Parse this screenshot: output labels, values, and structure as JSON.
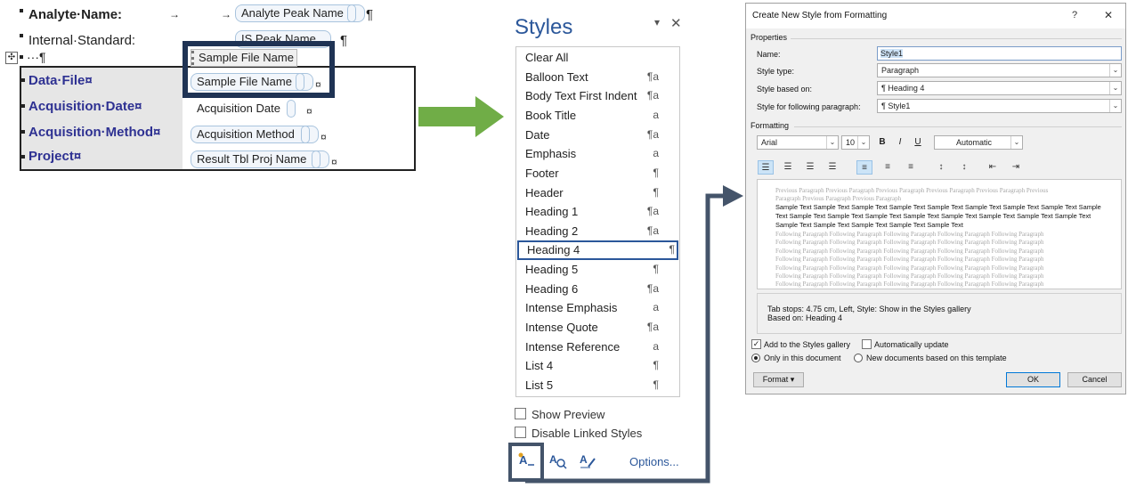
{
  "document": {
    "analyte_label": "Analyte·Name:",
    "analyte_field": "Analyte Peak Name",
    "internal_label": "Internal·Standard:",
    "is_field": "IS Peak Name",
    "empty_para": "···¶",
    "floating_field": "Sample File Name",
    "tab_arrow": "→",
    "pilcrow": "¶",
    "cell_mark": "¤",
    "rows": [
      {
        "label": "Data·File¤",
        "field": "Sample File Name"
      },
      {
        "label": "Acquisition·Date¤",
        "field": "Acquisition Date"
      },
      {
        "label": "Acquisition·Method¤",
        "field": "Acquisition Method"
      },
      {
        "label": "Project¤",
        "field": "Result Tbl Proj Name"
      }
    ]
  },
  "styles_pane": {
    "title": "Styles",
    "close": "✕",
    "dropdown": "▾",
    "items": [
      {
        "name": "Clear All",
        "icon": ""
      },
      {
        "name": "Balloon Text",
        "icon": "¶a"
      },
      {
        "name": "Body Text First Indent",
        "icon": "¶a"
      },
      {
        "name": "Book Title",
        "icon": "a"
      },
      {
        "name": "Date",
        "icon": "¶a"
      },
      {
        "name": "Emphasis",
        "icon": "a"
      },
      {
        "name": "Footer",
        "icon": "¶"
      },
      {
        "name": "Header",
        "icon": "¶"
      },
      {
        "name": "Heading 1",
        "icon": "¶a"
      },
      {
        "name": "Heading 2",
        "icon": "¶a"
      },
      {
        "name": "Heading 4",
        "icon": "¶"
      },
      {
        "name": "Heading 5",
        "icon": "¶"
      },
      {
        "name": "Heading 6",
        "icon": "¶a"
      },
      {
        "name": "Intense Emphasis",
        "icon": "a"
      },
      {
        "name": "Intense Quote",
        "icon": "¶a"
      },
      {
        "name": "Intense Reference",
        "icon": "a"
      },
      {
        "name": "List 4",
        "icon": "¶"
      },
      {
        "name": "List 5",
        "icon": "¶"
      }
    ],
    "selected_index": 10,
    "show_preview": "Show Preview",
    "disable_linked": "Disable Linked Styles",
    "options": "Options..."
  },
  "dialog": {
    "title": "Create New Style from Formatting",
    "help": "?",
    "close": "✕",
    "properties_heading": "Properties",
    "name_label": "Name:",
    "name_value": "Style1",
    "style_type_label": "Style type:",
    "style_type_value": "Paragraph",
    "based_on_label": "Style based on:",
    "based_on_value": "¶  Heading 4",
    "following_label": "Style for following paragraph:",
    "following_value": "¶  Style1",
    "formatting_heading": "Formatting",
    "font": "Arial",
    "size": "10",
    "bold": "B",
    "italic": "I",
    "underline": "U",
    "color": "Automatic",
    "preview_prev": [
      "Previous Paragraph Previous Paragraph Previous Paragraph Previous Paragraph Previous Paragraph Previous",
      "Paragraph Previous Paragraph Previous Paragraph"
    ],
    "preview_sample": [
      "Sample Text Sample Text Sample Text Sample Text Sample Text Sample Text Sample Text Sample Text Sample",
      "Text Sample Text Sample Text Sample Text Sample Text Sample Text Sample Text Sample Text Sample Text",
      "Sample Text Sample Text Sample Text Sample Text Sample Text"
    ],
    "preview_next": [
      "Following Paragraph Following Paragraph Following Paragraph Following Paragraph Following Paragraph",
      "Following Paragraph Following Paragraph Following Paragraph Following Paragraph Following Paragraph",
      "Following Paragraph Following Paragraph Following Paragraph Following Paragraph Following Paragraph",
      "Following Paragraph Following Paragraph Following Paragraph Following Paragraph Following Paragraph",
      "Following Paragraph Following Paragraph Following Paragraph Following Paragraph Following Paragraph",
      "Following Paragraph Following Paragraph Following Paragraph Following Paragraph Following Paragraph",
      "Following Paragraph Following Paragraph Following Paragraph Following Paragraph Following Paragraph"
    ],
    "description_1": "Tab stops:  4.75 cm, Left, Style: Show in the Styles gallery",
    "description_2": "Based on: Heading 4",
    "add_gallery": "Add to the Styles gallery",
    "auto_update": "Automatically update",
    "only_doc": "Only in this document",
    "new_docs": "New documents based on this template",
    "format_btn": "Format ▾",
    "ok_btn": "OK",
    "cancel_btn": "Cancel"
  },
  "colors": {
    "highlight_box": "#1f3354",
    "arrow_green": "#70ad47",
    "connector": "#44546a",
    "word_blue": "#2b579a",
    "label_blue": "#2e3192"
  }
}
